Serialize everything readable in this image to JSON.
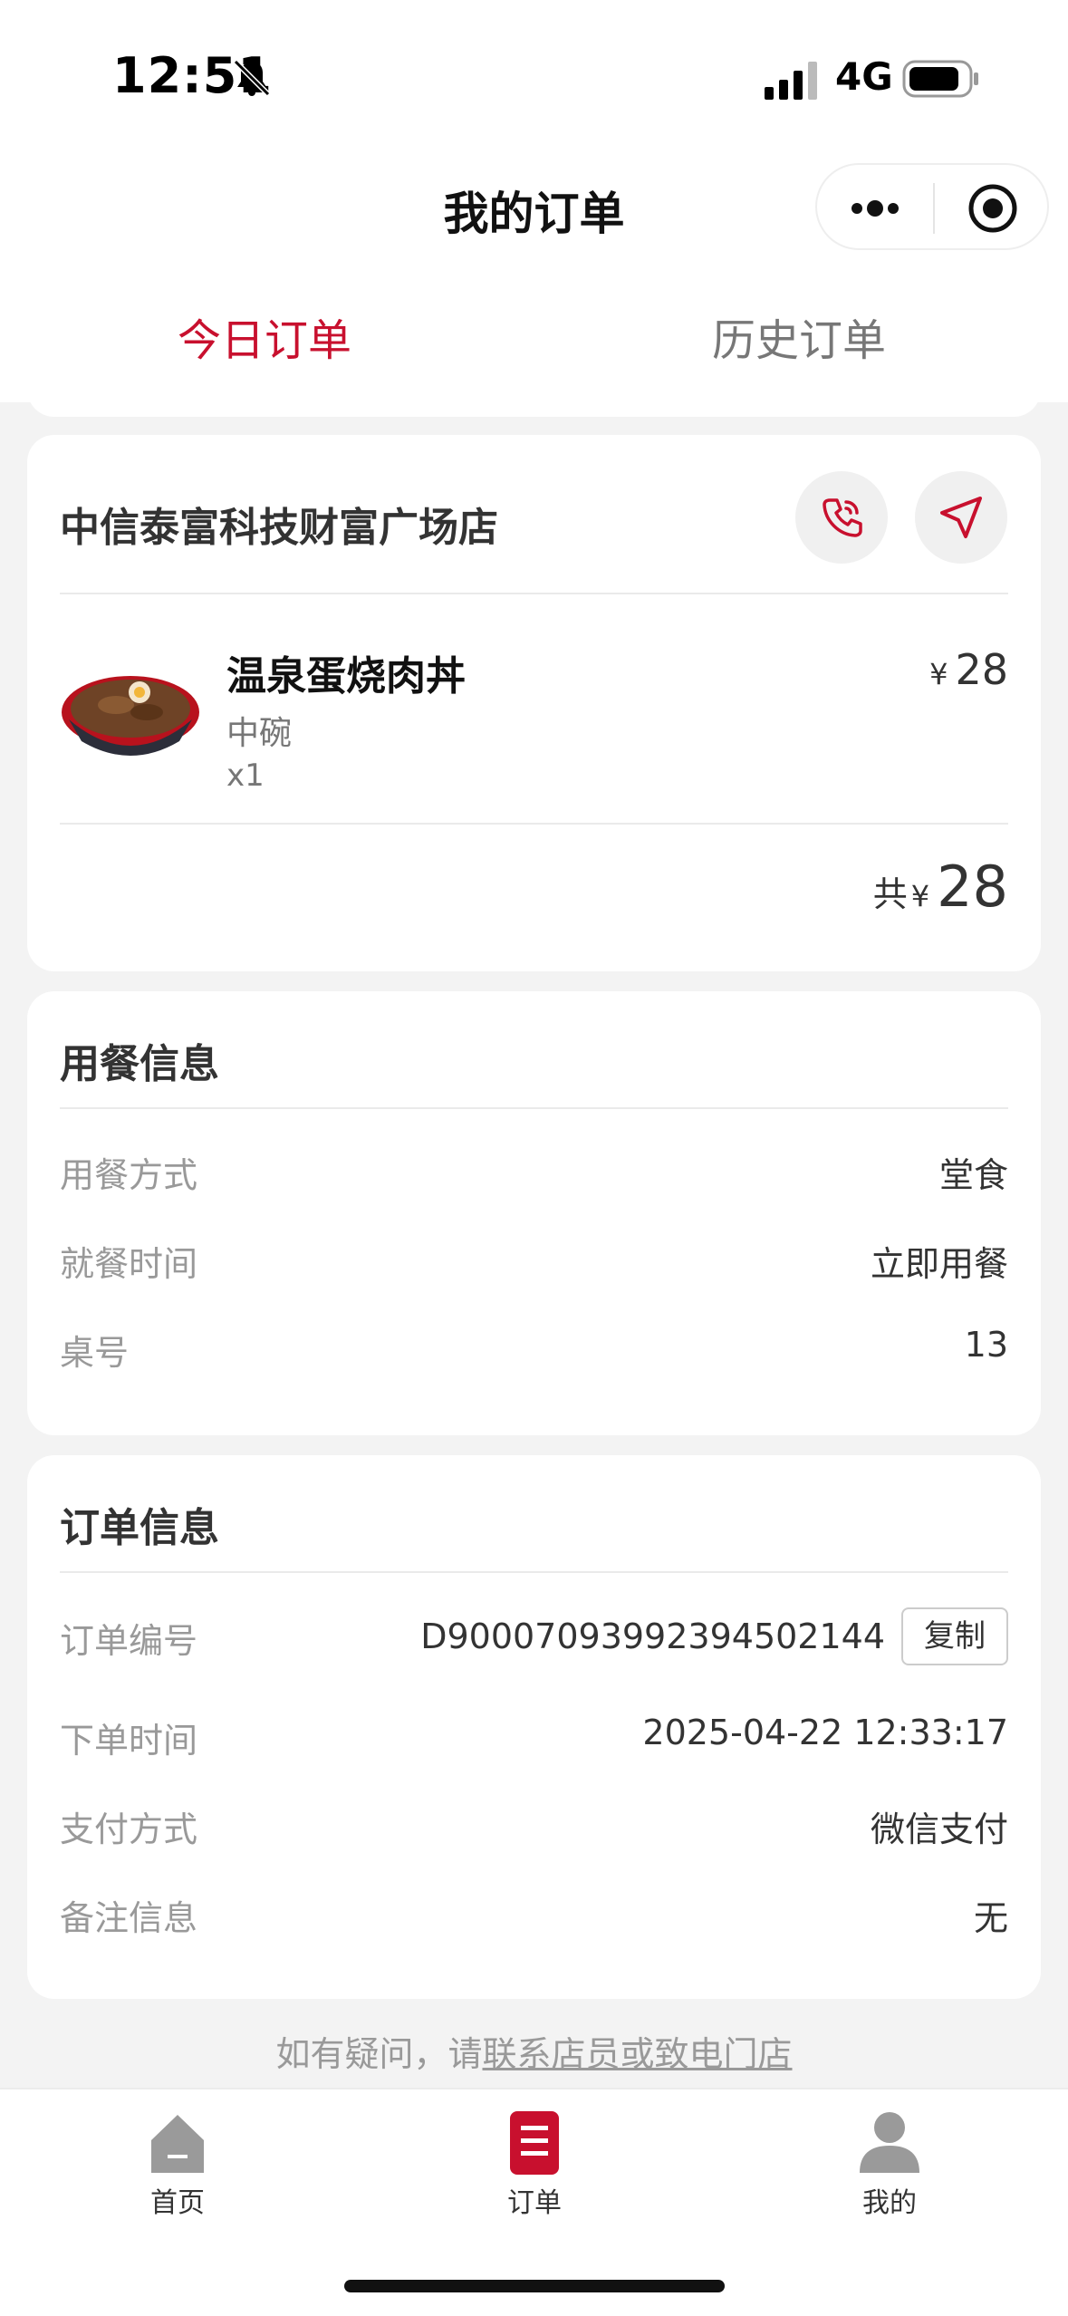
{
  "status_bar": {
    "time": "12:51",
    "network": "4G"
  },
  "nav": {
    "title": "我的订单"
  },
  "tabs": [
    {
      "label": "今日订单",
      "active": true
    },
    {
      "label": "历史订单",
      "active": false
    }
  ],
  "store": {
    "name": "中信泰富科技财富广场店",
    "item": {
      "name": "温泉蛋烧肉丼",
      "spec": "中碗",
      "qty": "x1",
      "currency": "¥",
      "price": "28"
    },
    "total": {
      "prefix": "共",
      "currency": "¥",
      "value": "28"
    }
  },
  "dining": {
    "title": "用餐信息",
    "rows": [
      {
        "label": "用餐方式",
        "value": "堂食"
      },
      {
        "label": "就餐时间",
        "value": "立即用餐"
      },
      {
        "label": "桌号",
        "value": "13"
      }
    ]
  },
  "order": {
    "title": "订单信息",
    "copy_label": "复制",
    "rows": [
      {
        "label": "订单编号",
        "value": "D900070939923945021​44"
      },
      {
        "label": "下单时间",
        "value": "2025-04-22 12:33:17"
      },
      {
        "label": "支付方式",
        "value": "微信支付"
      },
      {
        "label": "备注信息",
        "value": "无"
      }
    ]
  },
  "help": {
    "prefix": "如有疑问，请",
    "link": "联系店员或致电门店"
  },
  "tabbar": [
    {
      "label": "首页",
      "icon": "home-icon"
    },
    {
      "label": "订单",
      "icon": "order-icon"
    },
    {
      "label": "我的",
      "icon": "person-icon"
    }
  ],
  "colors": {
    "accent": "#c8102e",
    "background": "#f3f3f3"
  }
}
